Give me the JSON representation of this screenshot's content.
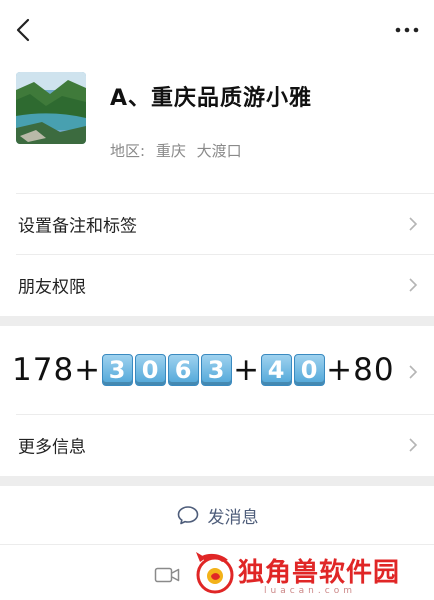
{
  "profile": {
    "name": "A、重庆品质游小雅",
    "region_label": "地区:",
    "region_city": "重庆",
    "region_area": "大渡口"
  },
  "rows": {
    "remark": "设置备注和标签",
    "permission": "朋友权限",
    "more_info": "更多信息"
  },
  "phone": {
    "prefix": "178+",
    "group1": [
      "3",
      "0",
      "6",
      "3"
    ],
    "plus1": "+",
    "group2": [
      "4",
      "0"
    ],
    "suffix": "+80"
  },
  "actions": {
    "send_message": "发消息"
  },
  "watermark": {
    "title": "独角兽软件园",
    "subtitle": "luacan.com"
  },
  "colors": {
    "accent_text": "#4e5d7a",
    "watermark": "#e02626",
    "keycap": "#4fa6d8"
  },
  "icons": [
    "back-icon",
    "more-icon",
    "chevron-right-icon",
    "chat-bubble-icon",
    "video-call-icon",
    "unicorn-logo-icon"
  ]
}
